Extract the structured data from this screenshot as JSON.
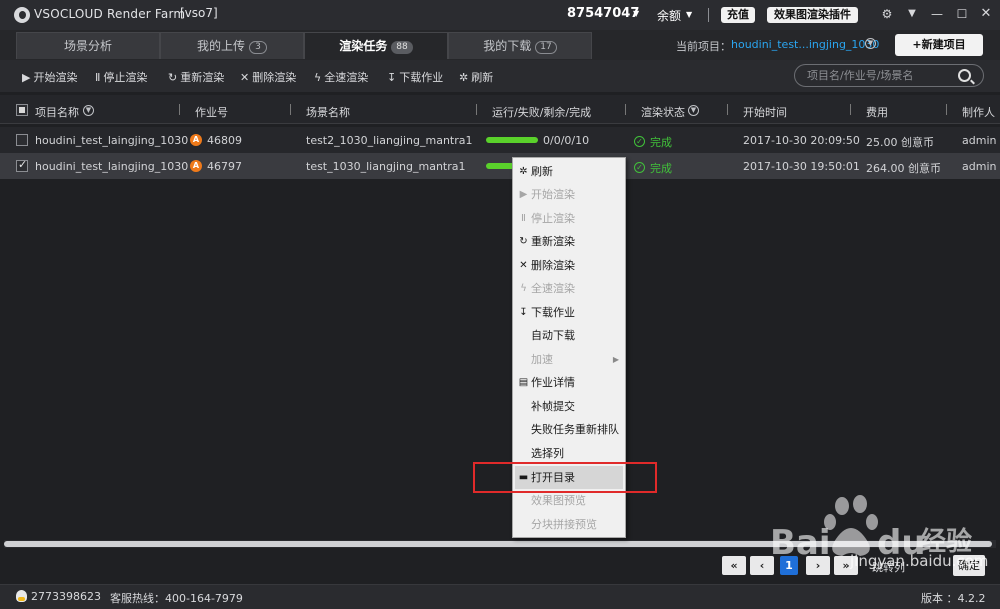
{
  "app": {
    "title": "VSOCLOUD Render Farm",
    "account": "[vso7]",
    "user_id": "87547047",
    "balance_label": "余额",
    "recharge_label": "充值",
    "plugin_label": "效果图渲染插件",
    "window_controls": [
      "gear-icon",
      "dropdown-icon",
      "minimize-icon",
      "maximize-icon",
      "close-icon"
    ]
  },
  "tabs": [
    {
      "label": "场景分析",
      "count": ""
    },
    {
      "label": "我的上传",
      "count": "3"
    },
    {
      "label": "渲染任务",
      "count": "88"
    },
    {
      "label": "我的下载",
      "count": "17"
    }
  ],
  "project": {
    "label": "当前项目：",
    "name": "houdini_test...ingjing_1030",
    "new_button": "+新建项目"
  },
  "toolbar": {
    "start": "开始渲染",
    "stop": "停止渲染",
    "rerender": "重新渲染",
    "delete": "删除渲染",
    "fullspeed": "全速渲染",
    "download": "下载作业",
    "refresh": "刷新",
    "search_placeholder": "项目名/作业号/场景名"
  },
  "table": {
    "headers": [
      "项目名称",
      "作业号",
      "场景名称",
      "运行/失败/剩余/完成",
      "渲染状态",
      "开始时间",
      "费用",
      "制作人"
    ],
    "rows": [
      {
        "checked": false,
        "project": "houdini_test_laingjing_1030",
        "badge": "A",
        "job": "46809",
        "scene": "test2_1030_liangjing_mantra1",
        "progress_text": "0/0/0/10",
        "progress": 1.0,
        "status": "完成",
        "start": "2017-10-30 20:09:50",
        "cost": "25.00 创意币",
        "owner": "admin"
      },
      {
        "checked": true,
        "project": "houdini_test_laingjing_1030",
        "badge": "A",
        "job": "46797",
        "scene": "test_1030_liangjing_mantra1",
        "progress_text": "",
        "progress": 1.0,
        "status": "完成",
        "start": "2017-10-30 19:50:01",
        "cost": "264.00 创意币",
        "owner": "admin"
      }
    ]
  },
  "context_menu": [
    {
      "label": "刷新",
      "icon": "refresh-icon",
      "glyph": "✲",
      "disabled": false
    },
    {
      "label": "开始渲染",
      "icon": "play-icon",
      "glyph": "▶",
      "disabled": true
    },
    {
      "label": "停止渲染",
      "icon": "pause-icon",
      "glyph": "Ⅱ",
      "disabled": true
    },
    {
      "label": "重新渲染",
      "icon": "rerender-icon",
      "glyph": "↻",
      "disabled": false
    },
    {
      "label": "删除渲染",
      "icon": "delete-icon",
      "glyph": "✕",
      "disabled": false
    },
    {
      "label": "全速渲染",
      "icon": "lightning-icon",
      "glyph": "ϟ",
      "disabled": true
    },
    {
      "label": "下载作业",
      "icon": "download-icon",
      "glyph": "↧",
      "disabled": false
    },
    {
      "label": "自动下载",
      "icon": "",
      "glyph": "",
      "disabled": false
    },
    {
      "label": "加速",
      "icon": "",
      "glyph": "",
      "disabled": true,
      "submenu": true
    },
    {
      "label": "作业详情",
      "icon": "details-icon",
      "glyph": "▤",
      "disabled": false
    },
    {
      "label": "补帧提交",
      "icon": "",
      "glyph": "",
      "disabled": false
    },
    {
      "label": "失败任务重新排队",
      "icon": "",
      "glyph": "",
      "disabled": false
    },
    {
      "label": "选择列",
      "icon": "",
      "glyph": "",
      "disabled": false
    },
    {
      "label": "打开目录",
      "icon": "folder-icon",
      "glyph": "▬",
      "disabled": false,
      "highlighted": true
    },
    {
      "label": "效果图预览",
      "icon": "",
      "glyph": "",
      "disabled": true
    },
    {
      "label": "分块拼接预览",
      "icon": "",
      "glyph": "",
      "disabled": true
    }
  ],
  "pagination": {
    "first": "«",
    "prev": "‹",
    "ellipsis": "...",
    "current": "1",
    "next": "›",
    "last": "»",
    "goto_label": "跳转列",
    "confirm": "确定"
  },
  "status_bar": {
    "qq": "2773398623",
    "hotline": "客服热线：400-164-7979",
    "version": "版本 ：4.2.2"
  },
  "watermark": {
    "text": "jingyan.baidu.com"
  },
  "colors": {
    "accent_blue": "#2aa5f0",
    "success_green": "#41c13a",
    "progress_green": "#5ad12b",
    "badge_orange": "#ef7a1a",
    "highlight_red": "#e02a2a"
  }
}
